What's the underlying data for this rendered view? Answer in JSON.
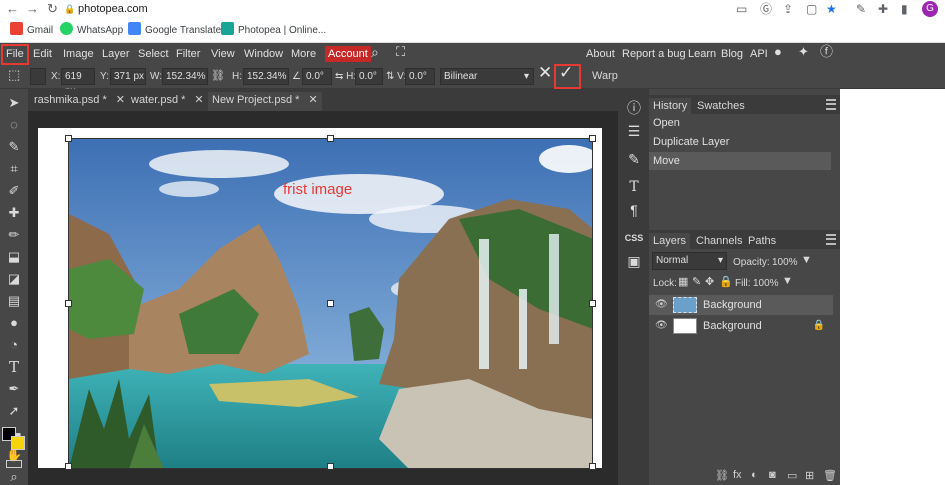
{
  "browser": {
    "address": "photopea.com",
    "nav": {
      "back": "←",
      "forward": "→",
      "reload": "↻",
      "lock": "🔒"
    },
    "bookmarks": [
      {
        "label": "Gmail",
        "color": "#ea4335"
      },
      {
        "label": "WhatsApp",
        "color": "#25d366"
      },
      {
        "label": "Google Translate",
        "color": "#4285f4"
      },
      {
        "label": "Photopea | Online...",
        "color": "#18a497"
      }
    ],
    "profile_initial": "G"
  },
  "menu": {
    "items": [
      "File",
      "Edit",
      "Image",
      "Layer",
      "Select",
      "Filter",
      "View",
      "Window",
      "More"
    ],
    "account": "Account",
    "right_items": [
      "About",
      "Report a bug",
      "Learn",
      "Blog",
      "API"
    ]
  },
  "options": {
    "x_label": "X:",
    "x_value": "619 px",
    "y_label": "Y:",
    "y_value": "371 px",
    "w_label": "W:",
    "w_value": "152.34%",
    "h_label": "H:",
    "h_value": "152.34%",
    "angle_label": "∠:",
    "angle_value": "0.0°",
    "hskew_label": "⇆ H:",
    "hskew_value": "0.0°",
    "vskew_label": "⇅ V:",
    "vskew_value": "0.0°",
    "interpolation": "Bilinear",
    "warp": "Warp",
    "cancel": "✕",
    "commit": "✓"
  },
  "tabs": [
    {
      "label": "rashmika.psd *",
      "close": "✕"
    },
    {
      "label": "water.psd *",
      "close": "✕"
    },
    {
      "label": "New Project.psd *",
      "close": "✕"
    }
  ],
  "canvas": {
    "photo_label": "frist image"
  },
  "history": {
    "tabs": [
      "History",
      "Swatches"
    ],
    "items": [
      "Open",
      "Duplicate Layer",
      "Move"
    ],
    "selected_index": 2
  },
  "layers": {
    "tabs": [
      "Layers",
      "Channels",
      "Paths"
    ],
    "blend_mode": "Normal",
    "opacity_label": "Opacity:",
    "opacity_value": "100%",
    "lock_label": "Lock:",
    "fill_label": "Fill:",
    "fill_value": "100%",
    "items": [
      {
        "name": "Background",
        "selected": true,
        "locked": false
      },
      {
        "name": "Background",
        "selected": false,
        "locked": true
      }
    ]
  },
  "colors": {
    "foreground": "#000000",
    "background": "#f5d50a",
    "highlight": "#e53935",
    "account": "#c62828"
  }
}
